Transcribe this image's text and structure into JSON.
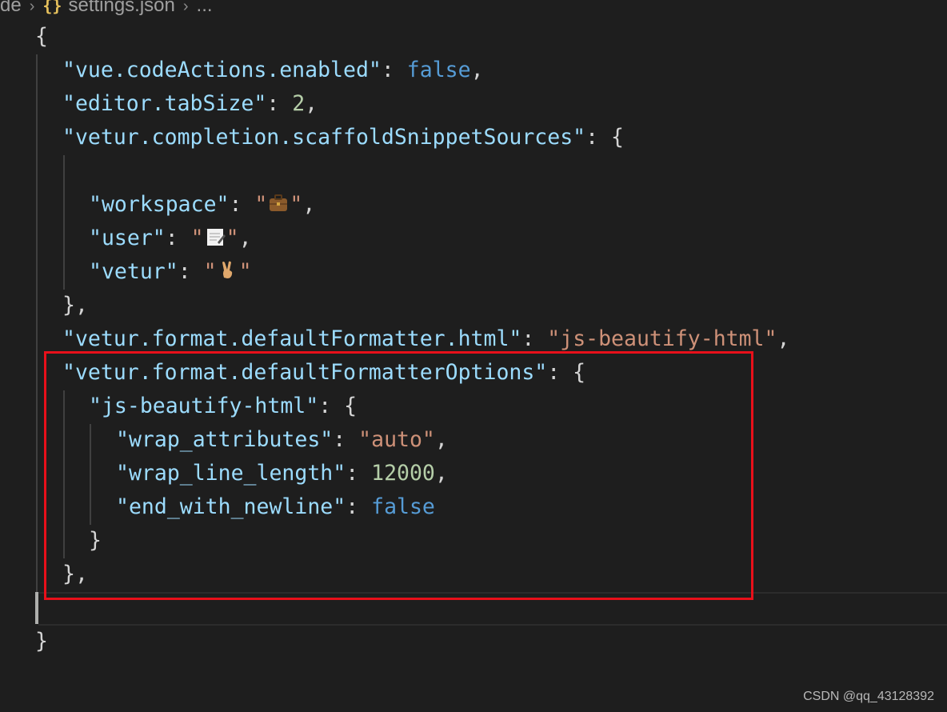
{
  "breadcrumb": {
    "prefix": "de",
    "file": "settings.json",
    "tail": "..."
  },
  "code": {
    "open_brace": "{",
    "close_brace": "}",
    "l1_key": "\"vue.codeActions.enabled\"",
    "l1_val": "false",
    "l2_key": "\"editor.tabSize\"",
    "l2_val": "2",
    "l3_key": "\"vetur.completion.scaffoldSnippetSources\"",
    "l5_key": "\"workspace\"",
    "l6_key": "\"user\"",
    "l7_key": "\"vetur\"",
    "l9_key": "\"vetur.format.defaultFormatter.html\"",
    "l9_val": "\"js-beautify-html\"",
    "l10_key": "\"vetur.format.defaultFormatterOptions\"",
    "l11_key": "\"js-beautify-html\"",
    "l12_key": "\"wrap_attributes\"",
    "l12_val": "\"auto\"",
    "l13_key": "\"wrap_line_length\"",
    "l13_val": "12000",
    "l14_key": "\"end_with_newline\"",
    "l14_val": "false"
  },
  "emoji_icons": [
    "briefcase-icon",
    "memo-icon",
    "victory-hand-icon"
  ],
  "colors": {
    "background": "#1e1e1e",
    "key": "#9cdcfe",
    "string": "#ce9178",
    "number": "#b5cea8",
    "boolean": "#569cd6",
    "highlight_box": "#e8101a"
  },
  "watermark": "CSDN @qq_43128392"
}
